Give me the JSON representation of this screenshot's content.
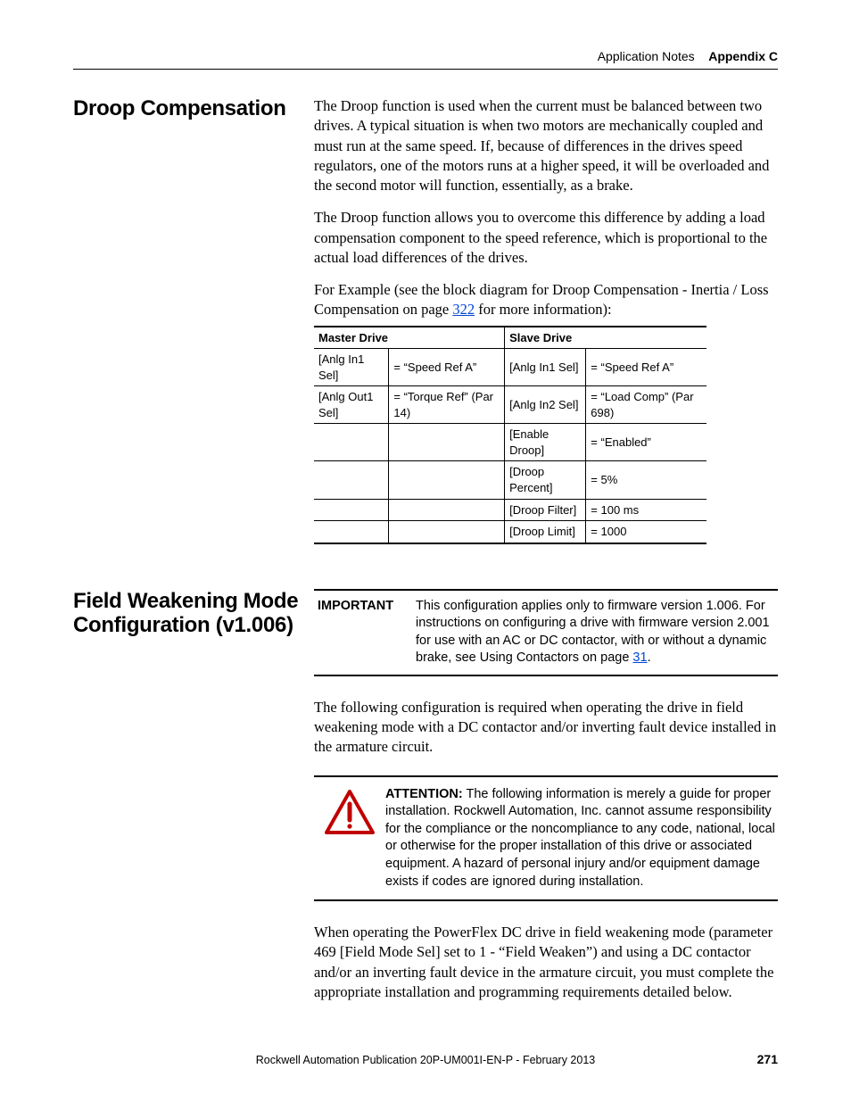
{
  "header": {
    "left": "Application Notes",
    "right": "Appendix C"
  },
  "sec1": {
    "heading": "Droop Compensation",
    "p1": "The Droop function is used when the current must be balanced between two drives. A typical situation is when two motors are mechanically coupled and must run at the same speed. If, because of differences in the drives speed regulators, one of the motors runs at a higher speed, it will be overloaded and the second motor will function, essentially, as a brake.",
    "p2": "The Droop function allows you to overcome this difference by adding a load compensation component to the speed reference, which is proportional to the actual load differences of the drives.",
    "p3a": "For Example (see the block diagram for Droop Compensation - Inertia / Loss Compensation on page ",
    "p3link": "322",
    "p3b": " for more information):",
    "table": {
      "h1": "Master Drive",
      "h2": "Slave Drive",
      "rows": [
        {
          "a": "[Anlg In1 Sel]",
          "b": "= “Speed Ref A”",
          "c": "[Anlg In1 Sel]",
          "d": "= “Speed Ref A”"
        },
        {
          "a": "[Anlg Out1 Sel]",
          "b": "= “Torque Ref” (Par 14)",
          "c": "[Anlg In2 Sel]",
          "d": "= “Load Comp” (Par 698)"
        },
        {
          "a": "",
          "b": "",
          "c": "[Enable Droop]",
          "d": "= “Enabled”"
        },
        {
          "a": "",
          "b": "",
          "c": "[Droop Percent]",
          "d": "= 5%"
        },
        {
          "a": "",
          "b": "",
          "c": "[Droop Filter]",
          "d": "= 100 ms"
        },
        {
          "a": "",
          "b": "",
          "c": "[Droop Limit]",
          "d": "= 1000"
        }
      ]
    }
  },
  "sec2": {
    "heading": "Field Weakening Mode Configuration (v1.006)",
    "important": {
      "label": "IMPORTANT",
      "text_a": "This configuration applies only to firmware version 1.006. For instructions on configuring a drive with firmware version 2.001 for use with an AC or DC contactor, with or without a dynamic brake, see Using Contactors on page ",
      "link": "31",
      "text_b": "."
    },
    "p1": "The following configuration is required when operating the drive in field weakening mode with a DC contactor and/or inverting fault device installed in the armature circuit.",
    "attention": {
      "label": "ATTENTION:",
      "text": " The following information is merely a guide for proper installation. Rockwell Automation, Inc. cannot assume responsibility for the compliance or the noncompliance to any code, national, local or otherwise for the proper installation of this drive or associated equipment. A hazard of personal injury and/or equipment damage exists if codes are ignored during installation."
    },
    "p2": "When operating the PowerFlex DC drive in field weakening mode (parameter 469 [Field Mode Sel] set to 1 - “Field Weaken”) and using a DC contactor and/or an inverting fault device in the armature circuit, you must complete the appropriate installation and programming requirements detailed below."
  },
  "footer": {
    "pub": "Rockwell Automation Publication 20P-UM001I-EN-P - February 2013",
    "page": "271"
  }
}
